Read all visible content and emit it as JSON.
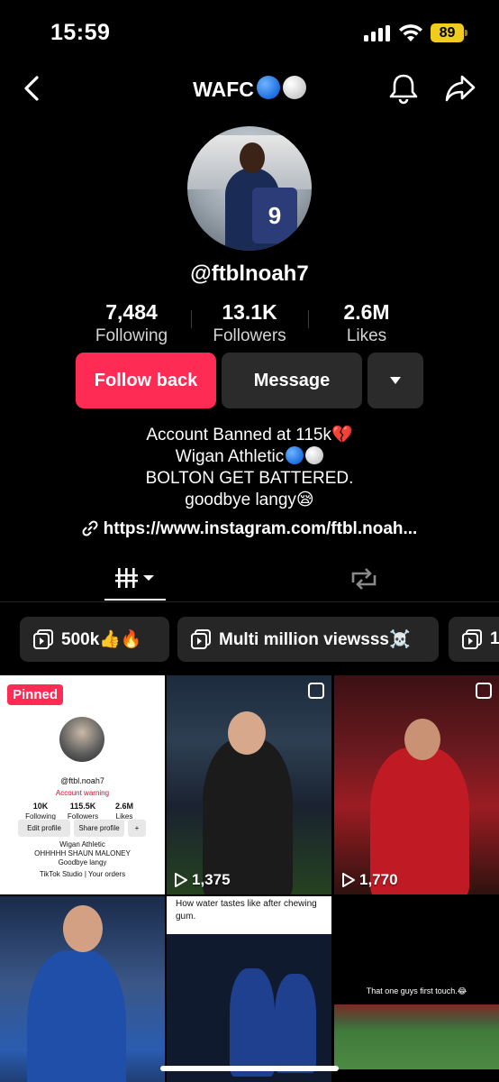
{
  "status_bar": {
    "time": "15:59",
    "battery": "89"
  },
  "nav": {
    "title": "WAFC"
  },
  "profile": {
    "username": "@ftblnoah7",
    "avatar_shirt_number": "9",
    "stats": [
      {
        "value": "7,484",
        "label": "Following"
      },
      {
        "value": "13.1K",
        "label": "Followers"
      },
      {
        "value": "2.6M",
        "label": "Likes"
      }
    ],
    "buttons": {
      "follow": "Follow back",
      "message": "Message"
    },
    "bio": {
      "line1": "Account Banned at 115k💔",
      "line2": "Wigan Athletic",
      "line3": "BOLTON GET BATTERED.",
      "line4": "goodbye langy😪"
    },
    "link": "https://www.instagram.com/ftbl.noah..."
  },
  "playlists": [
    {
      "label": "500k👍🔥"
    },
    {
      "label": "Multi million viewsss☠️"
    },
    {
      "label": "1"
    }
  ],
  "videos": {
    "pinned_label": "Pinned",
    "items": [
      {
        "views": ""
      },
      {
        "views": "1,375"
      },
      {
        "views": "1,770"
      }
    ],
    "thumb1": {
      "username": "@ftbl.noah7",
      "warning": "Account warning",
      "stats": [
        {
          "value": "10K",
          "label": "Following"
        },
        {
          "value": "115.5K",
          "label": "Followers"
        },
        {
          "value": "2.6M",
          "label": "Likes"
        }
      ],
      "edit": "Edit profile",
      "share": "Share profile",
      "bio1": "Wigan Athletic",
      "bio2": "OHHHHH SHAUN MALONEY",
      "bio3": "Goodbye langy",
      "studio": "TikTok Studio",
      "orders": "Your orders"
    },
    "thumb5_caption": "How water tastes like after chewing gum.",
    "thumb6_caption": "That one guys first touch.😂"
  },
  "colors": {
    "accent": "#fe2c55",
    "button_dark": "#2b2b2b",
    "battery": "#f2cc1d"
  }
}
